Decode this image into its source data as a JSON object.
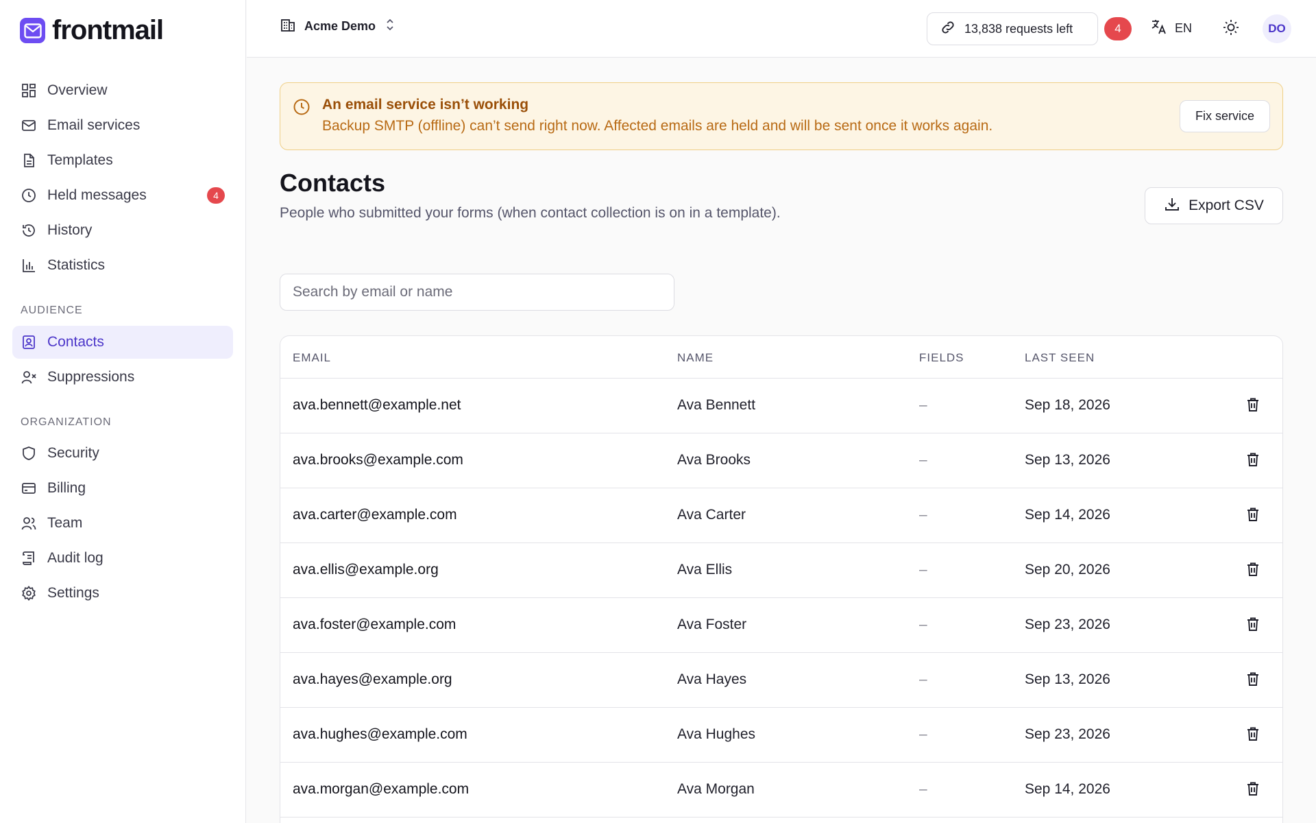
{
  "brand": {
    "name": "frontmail",
    "accent": "#6d4df2"
  },
  "sidebar": {
    "main": [
      {
        "label": "Overview",
        "icon": "grid-icon"
      },
      {
        "label": "Email services",
        "icon": "mail-icon"
      },
      {
        "label": "Templates",
        "icon": "file-text-icon"
      },
      {
        "label": "Held messages",
        "icon": "clock-icon",
        "badge": "4"
      },
      {
        "label": "History",
        "icon": "history-icon"
      },
      {
        "label": "Statistics",
        "icon": "bar-chart-icon"
      }
    ],
    "audience_label": "AUDIENCE",
    "audience": [
      {
        "label": "Contacts",
        "icon": "contact-card-icon",
        "active": true
      },
      {
        "label": "Suppressions",
        "icon": "user-x-icon"
      }
    ],
    "organization_label": "ORGANIZATION",
    "organization": [
      {
        "label": "Security",
        "icon": "shield-icon"
      },
      {
        "label": "Billing",
        "icon": "credit-card-icon"
      },
      {
        "label": "Team",
        "icon": "users-icon"
      },
      {
        "label": "Audit log",
        "icon": "scroll-icon"
      },
      {
        "label": "Settings",
        "icon": "gear-icon"
      }
    ]
  },
  "topbar": {
    "org_name": "Acme Demo",
    "requests_left": "13,838 requests left",
    "notifications": "4",
    "language": "EN",
    "avatar_initials": "DO"
  },
  "alert": {
    "title": "An email service isn’t working",
    "description": "Backup SMTP (offline) can’t send right now. Affected emails are held and will be sent once it works again.",
    "action_label": "Fix service",
    "color": "#9a4f08"
  },
  "page": {
    "title": "Contacts",
    "subtitle": "People who submitted your forms (when contact collection is on in a template).",
    "export_label": "Export CSV"
  },
  "search": {
    "placeholder": "Search by email or name",
    "value": ""
  },
  "table": {
    "headers": {
      "email": "EMAIL",
      "name": "NAME",
      "fields": "FIELDS",
      "last_seen": "LAST SEEN"
    },
    "rows": [
      {
        "email": "ava.bennett@example.net",
        "name": "Ava Bennett",
        "fields": "–",
        "last_seen": "Sep 18, 2026"
      },
      {
        "email": "ava.brooks@example.com",
        "name": "Ava Brooks",
        "fields": "–",
        "last_seen": "Sep 13, 2026"
      },
      {
        "email": "ava.carter@example.com",
        "name": "Ava Carter",
        "fields": "–",
        "last_seen": "Sep 14, 2026"
      },
      {
        "email": "ava.ellis@example.org",
        "name": "Ava Ellis",
        "fields": "–",
        "last_seen": "Sep 20, 2026"
      },
      {
        "email": "ava.foster@example.com",
        "name": "Ava Foster",
        "fields": "–",
        "last_seen": "Sep 23, 2026"
      },
      {
        "email": "ava.hayes@example.org",
        "name": "Ava Hayes",
        "fields": "–",
        "last_seen": "Sep 13, 2026"
      },
      {
        "email": "ava.hughes@example.com",
        "name": "Ava Hughes",
        "fields": "–",
        "last_seen": "Sep 23, 2026"
      },
      {
        "email": "ava.morgan@example.com",
        "name": "Ava Morgan",
        "fields": "–",
        "last_seen": "Sep 14, 2026"
      }
    ]
  }
}
